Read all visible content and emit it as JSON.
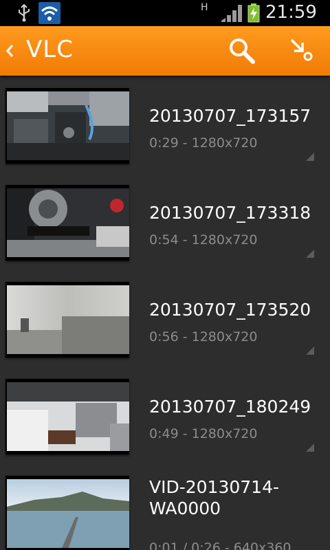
{
  "status_bar": {
    "network_type": "H",
    "time": "21:59"
  },
  "action_bar": {
    "title": "VLC",
    "back_icon": "chevron-left-icon",
    "search_icon": "search-icon",
    "shortcut_icon": "shortcut-icon"
  },
  "media_list": [
    {
      "title": "20130707_173157",
      "meta": "0:29 - 1280x720"
    },
    {
      "title": "20130707_173318",
      "meta": "0:54 - 1280x720"
    },
    {
      "title": "20130707_173520",
      "meta": "0:56 - 1280x720"
    },
    {
      "title": "20130707_180249",
      "meta": "0:49 - 1280x720"
    },
    {
      "title": "VID-20130714-WA0000",
      "title_line1": "VID-20130714-",
      "title_line2": "WA0000",
      "meta": "0:01 / 0:26 - 640x360"
    }
  ],
  "colors": {
    "accent": "#f7890f",
    "background": "#2d2d2d"
  }
}
